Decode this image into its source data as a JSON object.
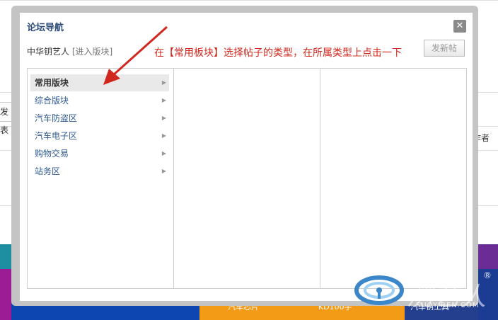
{
  "background": {
    "post_button_label": "发表",
    "author_label": "作者",
    "footer_labels": [
      "汽车芯片",
      "KD100手",
      "汽车钥工具"
    ]
  },
  "dialog": {
    "title": "论坛导航",
    "close_glyph": "✕",
    "user_name": "中华钥艺人",
    "enter_board_link": "[进入版块]",
    "post_new_button": "发新帖",
    "annotation": "在【常用板块】选择帖子的类型，在所属类型上点击一下",
    "categories": [
      {
        "label": "常用版块",
        "active": true
      },
      {
        "label": "综合版块",
        "active": false
      },
      {
        "label": "汽车防盗区",
        "active": false
      },
      {
        "label": "汽车电子区",
        "active": false
      },
      {
        "label": "购物交易",
        "active": false
      },
      {
        "label": "站务区",
        "active": false
      }
    ],
    "arrow_glyph": "▶"
  },
  "watermark": {
    "text": "测艺人",
    "sub": "SUOYIREN.COM",
    "reg": "®"
  },
  "colors": {
    "annotation": "#d0281f",
    "link": "#2f5a8e",
    "title": "#2b4a78"
  }
}
